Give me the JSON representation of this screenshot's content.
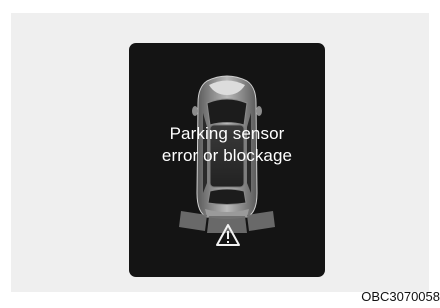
{
  "display": {
    "message_line1": "Parking sensor",
    "message_line2": "error or blockage",
    "warning_icon": "warning-triangle-icon",
    "vehicle_icon": "vehicle-top-view-icon"
  },
  "figure_code": "OBC3070058",
  "colors": {
    "panel_bg": "#efefef",
    "screen_bg": "#141414",
    "text": "#ffffff",
    "sensor_zone": "#6e6e6e"
  }
}
